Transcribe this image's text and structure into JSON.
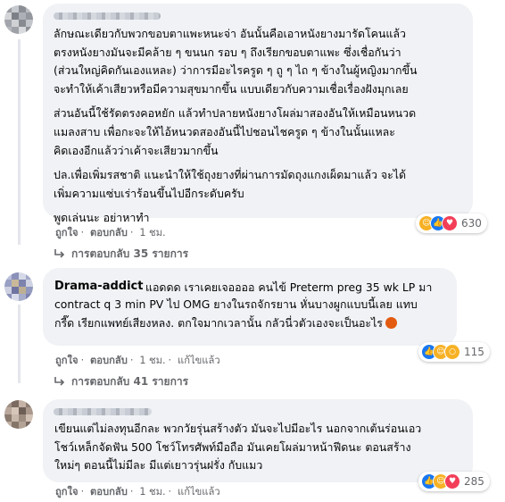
{
  "comments": [
    {
      "name": "",
      "text": [
        "ลักษณะเดียวกับพวกขอบตาแพะหนะจ่า อันนั้นคือเอาหนังยางมารัดโคนแล้ว",
        "ตรงหนังยางมันจะมีคล้าย ๆ ขนนก รอบ ๆ ถึงเรียกขอบตาแพะ ซึ่งเชื่อกันว่า",
        "(ส่วนใหญ่คิดกันเองแหละ) ว่าการมีอะไรครูด ๆ ถู ๆ ไถ ๆ ข้างในผู้หญิงมากขึ้น",
        "จะทำให้เค้าเสียวหรือมีความสุขมากขึ้น แบบเดียวกับความเชื่อเรื่องฝังมุกเลย",
        "ส่วนอันนี้ใช้รัดตรงคอหยัก แล้วทำปลายหนังยางโผล่มาสองอันให้เหมือนหนวด",
        "แมลงสาบ เพื่อกะจะให้ไอ้หนวดสองอันนี้ไปชอนไชครูด ๆ ข้างในนั้นแหละ",
        "คิดเองอีกแล้วว่าเค้าจะเสียวมากขึ้น",
        "ปล.เพื่อเพิ่มรสชาติ แนะนำให้ใช้ถุงยางที่ผ่านการมัดถุงแกงเผ็ดมาแล้ว จะได้",
        "เพิ่มความแซ่บเร่าร้อนขึ้นไปอีกระดับครับ",
        "พูดเล่นนะ อย่าหาทำ"
      ],
      "like": "ถูกใจ",
      "reply": "ตอบกลับ",
      "time": "1 ชม.",
      "reaction_count": "630",
      "replies_label": "การตอบกลับ 35 รายการ"
    },
    {
      "name": "Drama-addict",
      "text": [
        "แอดดด เราเคยเจออออ คนไข้ Preterm preg 35 wk LP มา",
        "contract q 3 min PV ไป OMG ยางในรถจักรยาน หั่นบางผูกแบบนี้เลย แทบ",
        "กรี๊ด เรียกแพทย์เสียงหลง. ตกใจมากเวลานั้น กลัวนี่วตัวเองจะเป็นอะไร"
      ],
      "like": "ถูกใจ",
      "reply": "ตอบกลับ",
      "time": "1 ชม.",
      "edited": "แก้ไขแล้ว",
      "reaction_count": "115",
      "replies_label": "การตอบกลับ 41 รายการ"
    },
    {
      "name": "",
      "text": [
        "เขียนแต่ไม่ลงทุนอีกละ พวกวัยรุ่นสร้างตัว มันจะไปมีอะไร นอกจากเต้นร่อนเอว",
        "โชว์เหล็กจัดฟัน 500 โชว์โทรศัพท์มือถือ มันเคยโผล่มาหน้าฟีดนะ ตอนสร้าง",
        "ใหม่ๆ ตอนนี้ไม่มีละ มีแต่เยาวรุ่นฝรั่ง กับแมว"
      ],
      "like": "ถูกใจ",
      "reply": "ตอบกลับ",
      "time": "1 ชม.",
      "edited": "แก้ไขแล้ว",
      "reaction_count": "285"
    }
  ],
  "colors": {
    "bubble": "#f0f2f5",
    "meta": "#65676b",
    "like_blue": "#1877f2",
    "love_red": "#f33e58",
    "haha_yellow": "#f7b125"
  },
  "icons": {
    "reply_arrow": "reply-arrow-icon",
    "reactions": [
      "haha-icon",
      "like-icon",
      "love-icon",
      "wow-icon",
      "angry-icon"
    ]
  }
}
